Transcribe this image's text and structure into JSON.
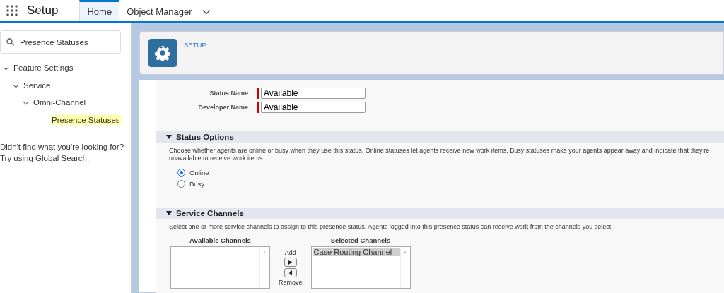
{
  "app": {
    "title": "Setup"
  },
  "tabs": [
    {
      "label": "Home",
      "selected": true
    },
    {
      "label": "Object Manager",
      "selected": false
    }
  ],
  "search": {
    "value": "Presence Statuses"
  },
  "tree": [
    {
      "label": "Feature Settings",
      "expanded": true,
      "children": [
        {
          "label": "Service",
          "expanded": true,
          "children": [
            {
              "label": "Omni-Channel",
              "expanded": true,
              "children": [
                {
                  "label": "Presence Statuses",
                  "selected": true
                }
              ]
            }
          ]
        }
      ]
    }
  ],
  "help": [
    "Didn't find what you're looking for?",
    "Try using Global Search."
  ],
  "header": {
    "label": "SETUP"
  },
  "fields": [
    {
      "label": "Status Name",
      "value": "Available",
      "required": true
    },
    {
      "label": "Developer Name",
      "value": "Available",
      "required": true
    }
  ],
  "sections": [
    {
      "kind": "options",
      "title": "Status Options",
      "expanded": true,
      "description": "Choose whether agents are online or busy when they use this status. Online statuses let agents receive new work items. Busy statuses make your agents appear away and indicate that they're unavailable to receive work items.",
      "options": [
        {
          "label": "Online",
          "selected": true
        },
        {
          "label": "Busy",
          "selected": false
        }
      ]
    },
    {
      "kind": "channels",
      "title": "Service Channels",
      "expanded": true,
      "description": "Select one or more service channels to assign to this presence status. Agents logged into this presence status can receive work from the channels you select.",
      "available": {
        "title": "Available Channels"
      },
      "add_label": "Add",
      "remove_label": "Remove",
      "chosen": {
        "title": "Selected Channels",
        "items": [
          {
            "label": "Case Routing Channel",
            "selected": true
          }
        ]
      }
    }
  ]
}
